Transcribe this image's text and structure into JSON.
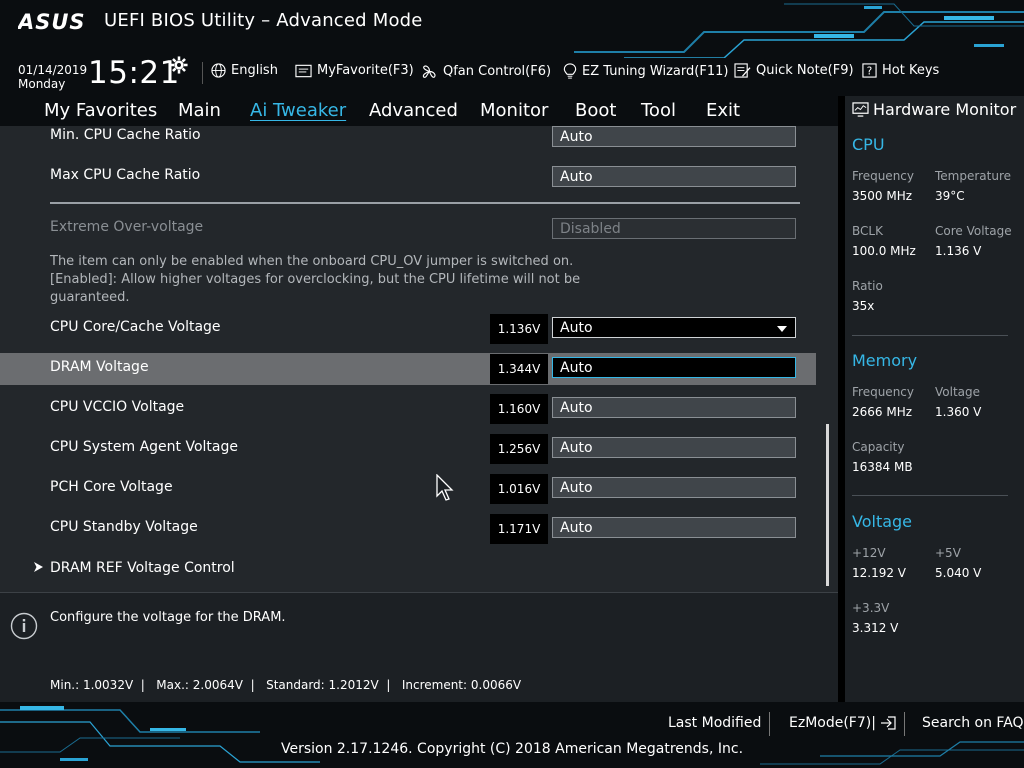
{
  "header": {
    "title": "UEFI BIOS Utility – Advanced Mode",
    "logo_text": "ASUS"
  },
  "toolbar": {
    "date": "01/14/2019",
    "day": "Monday",
    "time": "15:21",
    "language": "English",
    "myfavorite": "MyFavorite(F3)",
    "qfan": "Qfan Control(F6)",
    "ez_tuning": "EZ Tuning Wizard(F11)",
    "quick_note": "Quick Note(F9)",
    "hot_keys": "Hot Keys"
  },
  "tabs": [
    {
      "label": "My Favorites",
      "active": false
    },
    {
      "label": "Main",
      "active": false
    },
    {
      "label": "Ai Tweaker",
      "active": true
    },
    {
      "label": "Advanced",
      "active": false
    },
    {
      "label": "Monitor",
      "active": false
    },
    {
      "label": "Boot",
      "active": false
    },
    {
      "label": "Tool",
      "active": false
    },
    {
      "label": "Exit",
      "active": false
    }
  ],
  "settings": {
    "min_cpu_cache_ratio": {
      "label": "Min. CPU Cache Ratio",
      "value": "Auto"
    },
    "max_cpu_cache_ratio": {
      "label": "Max CPU Cache Ratio",
      "value": "Auto"
    },
    "extreme_overvoltage": {
      "label": "Extreme Over-voltage",
      "value": "Disabled"
    },
    "help_lines": [
      "The item can only be enabled when the onboard CPU_OV jumper is switched on.",
      "[Enabled]: Allow higher voltages for overclocking, but the CPU lifetime will not be",
      "guaranteed."
    ],
    "cpu_core_cache_voltage": {
      "label": "CPU Core/Cache Voltage",
      "reading": "1.136V",
      "value": "Auto"
    },
    "dram_voltage": {
      "label": "DRAM Voltage",
      "reading": "1.344V",
      "value": "Auto"
    },
    "cpu_vccio_voltage": {
      "label": "CPU VCCIO Voltage",
      "reading": "1.160V",
      "value": "Auto"
    },
    "cpu_system_agent_voltage": {
      "label": "CPU System Agent Voltage",
      "reading": "1.256V",
      "value": "Auto"
    },
    "pch_core_voltage": {
      "label": "PCH Core Voltage",
      "reading": "1.016V",
      "value": "Auto"
    },
    "cpu_standby_voltage": {
      "label": "CPU Standby Voltage",
      "reading": "1.171V",
      "value": "Auto"
    },
    "dram_ref_voltage_control": {
      "label": "DRAM REF Voltage Control"
    }
  },
  "info": {
    "description": "Configure the voltage for the DRAM.",
    "range": "Min.: 1.0032V  |   Max.: 2.0064V  |   Standard: 1.2012V  |   Increment: 0.0066V"
  },
  "hardware_monitor": {
    "title": "Hardware Monitor",
    "cpu": {
      "heading": "CPU",
      "frequency_label": "Frequency",
      "frequency": "3500 MHz",
      "temperature_label": "Temperature",
      "temperature": "39°C",
      "bclk_label": "BCLK",
      "bclk": "100.0 MHz",
      "core_voltage_label": "Core Voltage",
      "core_voltage": "1.136 V",
      "ratio_label": "Ratio",
      "ratio": "35x"
    },
    "memory": {
      "heading": "Memory",
      "frequency_label": "Frequency",
      "frequency": "2666 MHz",
      "voltage_label": "Voltage",
      "voltage": "1.360 V",
      "capacity_label": "Capacity",
      "capacity": "16384 MB"
    },
    "voltage": {
      "heading": "Voltage",
      "v12_label": "+12V",
      "v12": "12.192 V",
      "v5_label": "+5V",
      "v5": "5.040 V",
      "v33_label": "+3.3V",
      "v33": "3.312 V"
    }
  },
  "footer": {
    "last_modified": "Last Modified",
    "ezmode": "EzMode(F7)|",
    "search_faq": "Search on FAQ",
    "copyright": "Version 2.17.1246. Copyright (C) 2018 American Megatrends, Inc."
  },
  "colors": {
    "accent": "#36b7e6",
    "panel": "#23272b",
    "highlight_row": "#6b6d70"
  }
}
